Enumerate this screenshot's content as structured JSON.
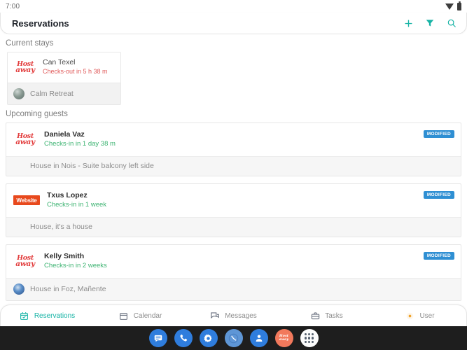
{
  "status_bar": {
    "time": "7:00",
    "icons": [
      "wifi-icon",
      "battery-icon"
    ]
  },
  "app_bar": {
    "title": "Reservations",
    "actions": [
      {
        "name": "add-icon",
        "glyph": "+"
      },
      {
        "name": "filter-icon",
        "glyph": "filter"
      },
      {
        "name": "search-icon",
        "glyph": "search"
      }
    ]
  },
  "current_stays": {
    "section_label": "Current stays",
    "stay": {
      "channel_logo": {
        "name": "hostaway-logo",
        "line1": "Host",
        "line2": "away"
      },
      "guest_name": "Can Texel",
      "status_text": "Checks-out in 5 h 38 m",
      "property_name": "Calm Retreat",
      "property_thumb": "property-thumbnail"
    }
  },
  "upcoming_guests": {
    "section_label": "Upcoming guests",
    "badge_label": "MODIFIED",
    "cards": [
      {
        "channel": "hostaway",
        "logo_line1": "Host",
        "logo_line2": "away",
        "guest_name": "Daniela Vaz",
        "status_text": "Checks-in in 1 day 38 m",
        "badge": "MODIFIED",
        "property_name": "House in Nois - Suite balcony left side",
        "has_thumb": false
      },
      {
        "channel": "website",
        "logo_text": "Website",
        "guest_name": "Txus Lopez",
        "status_text": "Checks-in in 1 week",
        "badge": "MODIFIED",
        "property_name": "House, it's a house",
        "has_thumb": false
      },
      {
        "channel": "hostaway",
        "logo_line1": "Host",
        "logo_line2": "away",
        "guest_name": "Kelly Smith",
        "status_text": "Checks-in in 2 weeks",
        "badge": "MODIFIED",
        "property_name": "House in Foz, Mañente",
        "has_thumb": true
      }
    ]
  },
  "bottom_nav": {
    "items": [
      {
        "label": "Reservations",
        "icon": "calendar-check-icon",
        "active": true
      },
      {
        "label": "Calendar",
        "icon": "calendar-icon",
        "active": false
      },
      {
        "label": "Messages",
        "icon": "chat-bubbles-icon",
        "active": false
      },
      {
        "label": "Tasks",
        "icon": "briefcase-icon",
        "active": false
      },
      {
        "label": "User",
        "icon": "user-avatar-icon",
        "active": false
      }
    ]
  },
  "android_dock": {
    "apps": [
      {
        "name": "messages-app-icon"
      },
      {
        "name": "phone-app-icon"
      },
      {
        "name": "settings-app-icon"
      },
      {
        "name": "clock-app-icon"
      },
      {
        "name": "contacts-app-icon"
      },
      {
        "name": "hostaway-app-icon",
        "line1": "Host",
        "line2": "away"
      },
      {
        "name": "app-drawer-icon"
      }
    ]
  },
  "colors": {
    "accent_teal": "#16b3a5",
    "badge_blue": "#2f8fd3",
    "website_orange": "#e8491d",
    "hostaway_red": "#e23b3b",
    "checkin_green": "#3cb371",
    "checkout_red": "#e05a5a"
  }
}
